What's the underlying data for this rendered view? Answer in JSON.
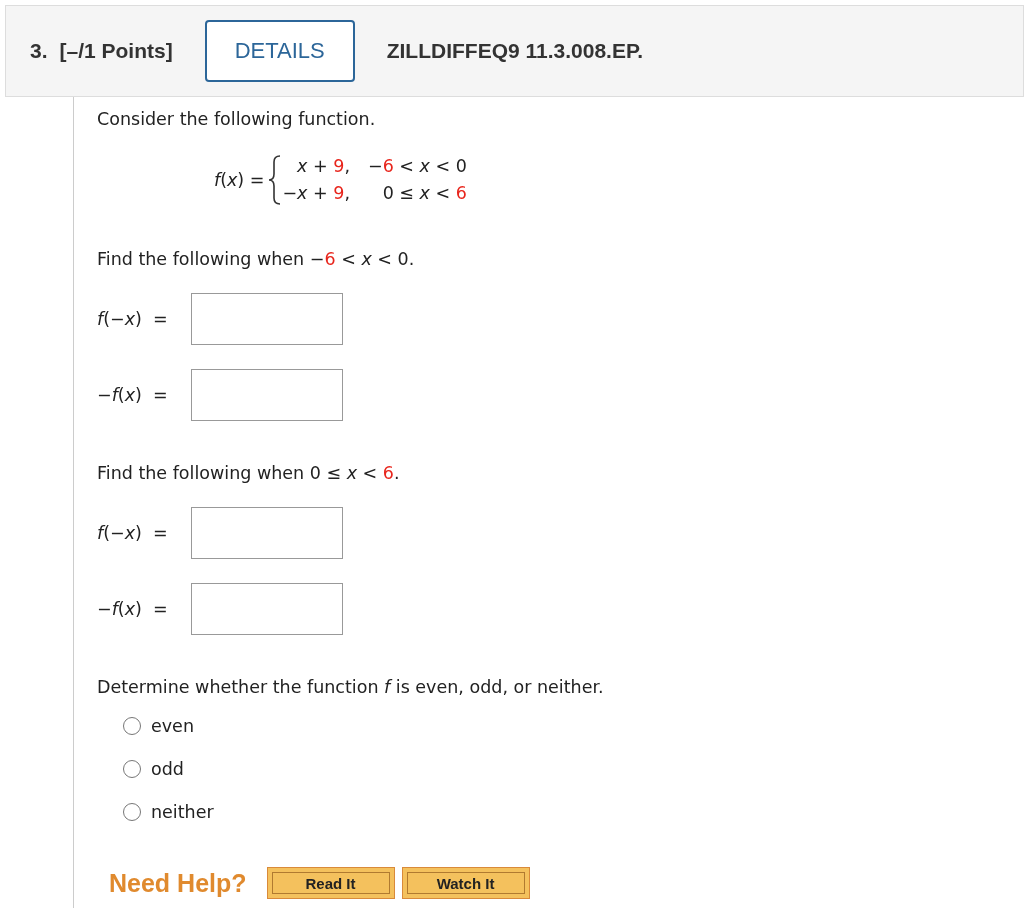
{
  "header": {
    "number": "3.",
    "points": "[–/1 Points]",
    "details_button": "DETAILS",
    "code": "ZILLDIFFEQ9 11.3.008.EP."
  },
  "intro": "Consider the following function.",
  "function": {
    "lhs": "*f*(*x*) =",
    "cases": [
      {
        "expr": [
          {
            "kind": "plain",
            "text": "*x* + "
          },
          {
            "kind": "given",
            "text": "9"
          },
          {
            "kind": "plain",
            "text": ","
          }
        ],
        "cond": [
          {
            "kind": "plain",
            "text": "−"
          },
          {
            "kind": "given",
            "text": "6"
          },
          {
            "kind": "plain",
            "text": " < *x* < 0"
          }
        ]
      },
      {
        "expr": [
          {
            "kind": "plain",
            "text": "−*x* + "
          },
          {
            "kind": "given",
            "text": "9"
          },
          {
            "kind": "plain",
            "text": ","
          }
        ],
        "cond": [
          {
            "kind": "plain",
            "text": "0 ≤ *x* < "
          },
          {
            "kind": "given",
            "text": "6"
          }
        ]
      }
    ]
  },
  "parts": [
    {
      "prompt": [
        {
          "kind": "plain",
          "text": "Find the following when −"
        },
        {
          "kind": "given",
          "text": "6"
        },
        {
          "kind": "plain",
          "text": " < *x* < 0."
        }
      ],
      "answers": [
        {
          "label": "*f*(−*x*)  ="
        },
        {
          "label": "−*f*(*x*)  ="
        }
      ]
    },
    {
      "prompt": [
        {
          "kind": "plain",
          "text": "Find the following when 0 ≤ *x* < "
        },
        {
          "kind": "given",
          "text": "6"
        },
        {
          "kind": "plain",
          "text": "."
        }
      ],
      "answers": [
        {
          "label": "*f*(−*x*)  ="
        },
        {
          "label": "−*f*(*x*)  ="
        }
      ]
    }
  ],
  "question": "Determine whether the function *f* is even, odd, or neither.",
  "options": [
    {
      "label": "even",
      "selected": false
    },
    {
      "label": "odd",
      "selected": false
    },
    {
      "label": "neither",
      "selected": false
    }
  ],
  "help": {
    "label": "Need Help?",
    "buttons": [
      "Read It",
      "Watch It"
    ]
  }
}
